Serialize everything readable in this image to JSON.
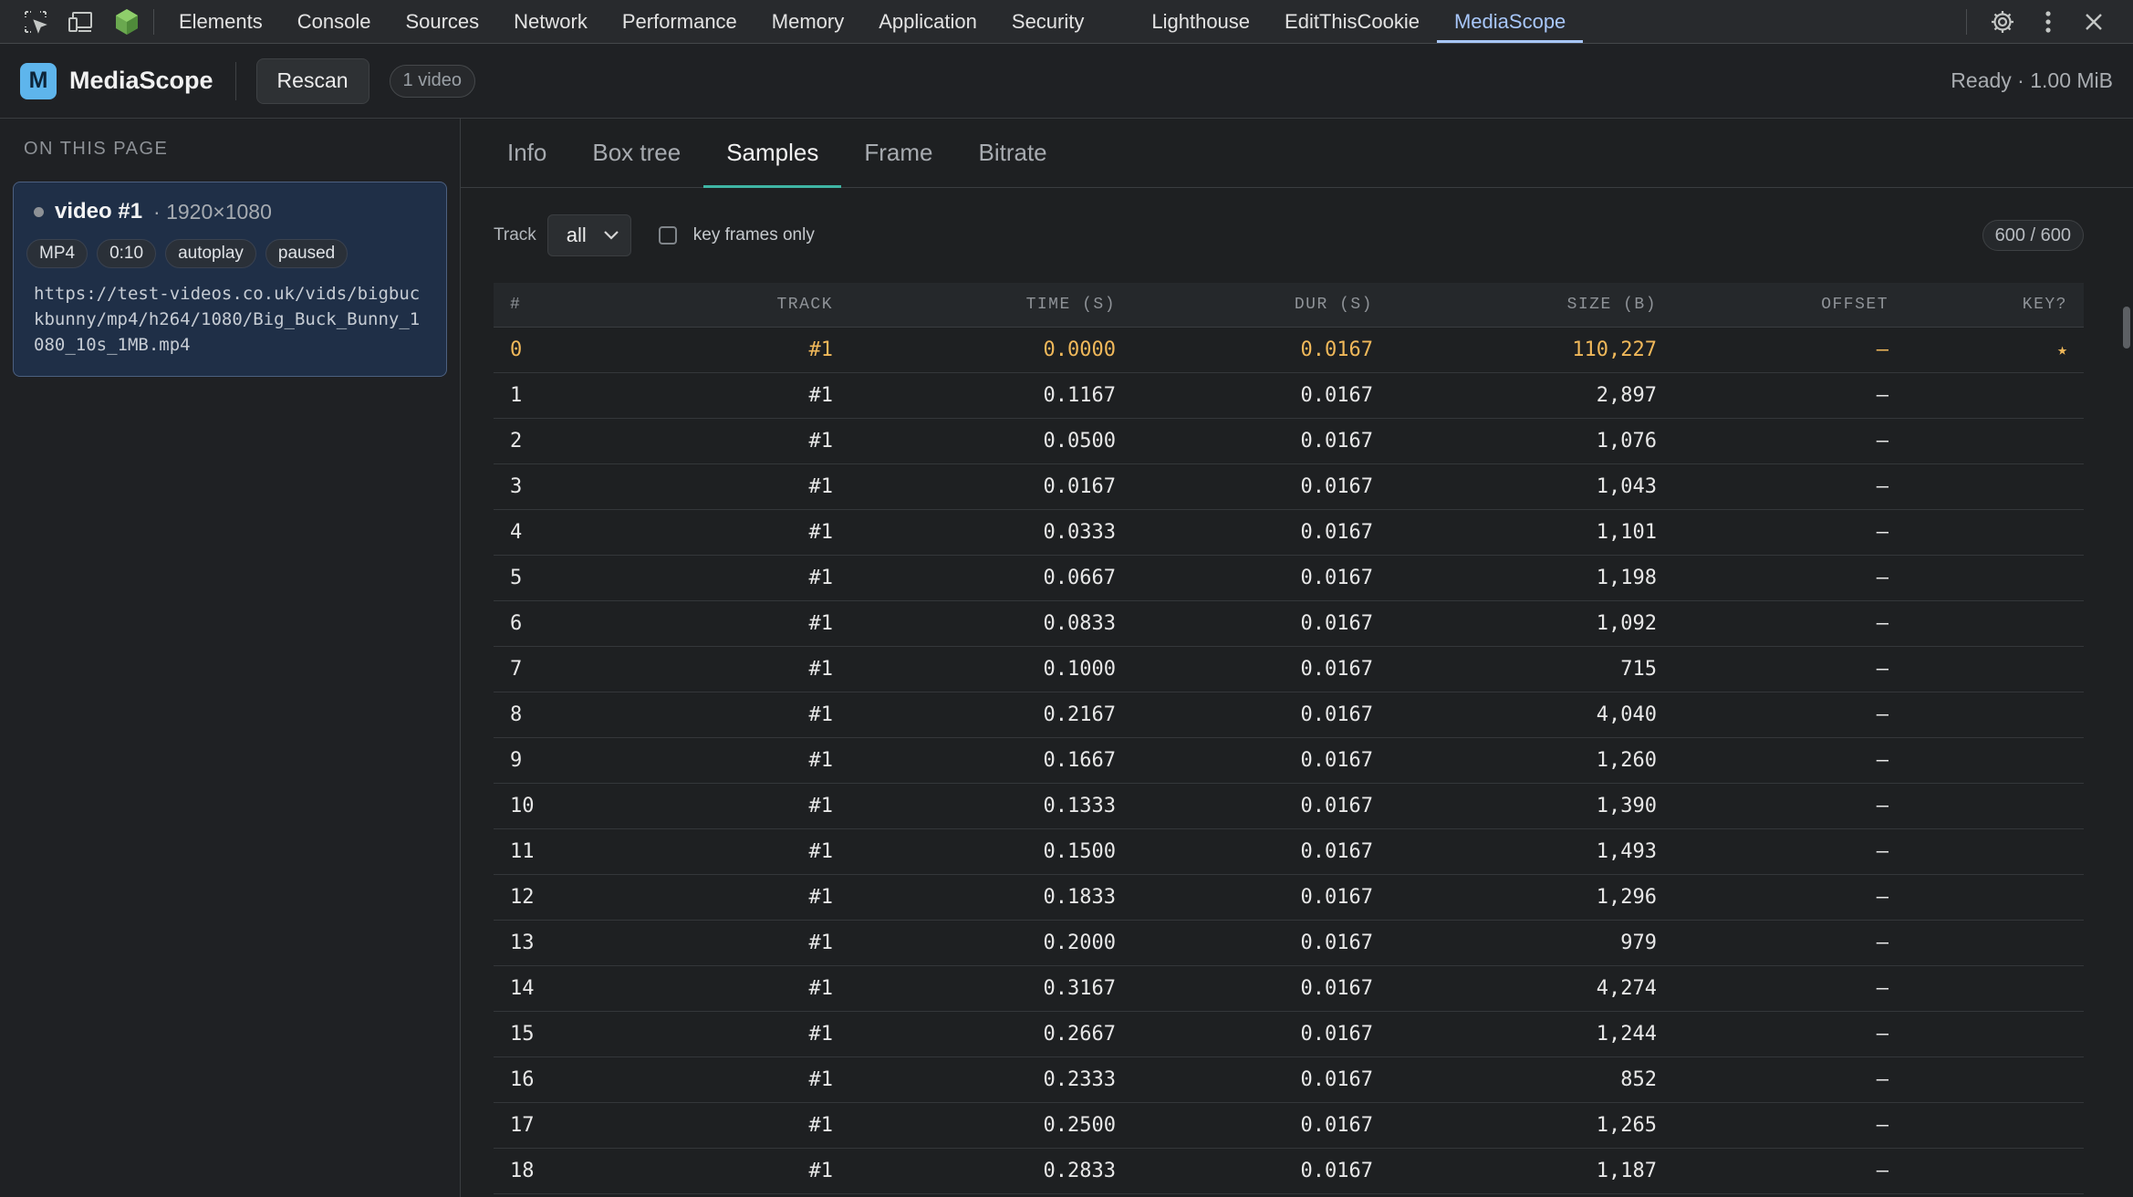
{
  "devtools": {
    "tabs": [
      "Elements",
      "Console",
      "Sources",
      "Network",
      "Performance",
      "Memory",
      "Application",
      "Security",
      "Lighthouse",
      "EditThisCookie",
      "MediaScope"
    ],
    "active_tab": "MediaScope",
    "left_icons": [
      "inspect-element-icon",
      "device-toolbar-icon",
      "extension-cube-icon"
    ],
    "right_icons": [
      "settings-gear-icon",
      "more-options-icon",
      "close-icon"
    ]
  },
  "header": {
    "logo_letter": "M",
    "app_name": "MediaScope",
    "rescan_label": "Rescan",
    "video_count": "1 video",
    "status": "Ready · 1.00 MiB"
  },
  "sidebar": {
    "heading": "ON THIS PAGE",
    "video": {
      "name": "video #1",
      "resolution": "· 1920×1080",
      "chips": [
        "MP4",
        "0:10",
        "autoplay",
        "paused"
      ],
      "url": "https://test-videos.co.uk/vids/bigbuckbunny/mp4/h264/1080/Big_Buck_Bunny_1080_10s_1MB.mp4"
    }
  },
  "subtabs": {
    "items": [
      "Info",
      "Box tree",
      "Samples",
      "Frame",
      "Bitrate"
    ],
    "active": "Samples"
  },
  "filters": {
    "track_label": "Track",
    "track_value": "all",
    "keyframes_label": "key frames only",
    "keyframes_checked": false,
    "total": "600 / 600"
  },
  "table": {
    "columns": [
      "#",
      "TRACK",
      "TIME (S)",
      "DUR (S)",
      "SIZE (B)",
      "OFFSET",
      "KEY?"
    ],
    "rows": [
      [
        "0",
        "#1",
        "0.0000",
        "0.0167",
        "110,227",
        "—",
        "★"
      ],
      [
        "1",
        "#1",
        "0.1167",
        "0.0167",
        "2,897",
        "—",
        ""
      ],
      [
        "2",
        "#1",
        "0.0500",
        "0.0167",
        "1,076",
        "—",
        ""
      ],
      [
        "3",
        "#1",
        "0.0167",
        "0.0167",
        "1,043",
        "—",
        ""
      ],
      [
        "4",
        "#1",
        "0.0333",
        "0.0167",
        "1,101",
        "—",
        ""
      ],
      [
        "5",
        "#1",
        "0.0667",
        "0.0167",
        "1,198",
        "—",
        ""
      ],
      [
        "6",
        "#1",
        "0.0833",
        "0.0167",
        "1,092",
        "—",
        ""
      ],
      [
        "7",
        "#1",
        "0.1000",
        "0.0167",
        "715",
        "—",
        ""
      ],
      [
        "8",
        "#1",
        "0.2167",
        "0.0167",
        "4,040",
        "—",
        ""
      ],
      [
        "9",
        "#1",
        "0.1667",
        "0.0167",
        "1,260",
        "—",
        ""
      ],
      [
        "10",
        "#1",
        "0.1333",
        "0.0167",
        "1,390",
        "—",
        ""
      ],
      [
        "11",
        "#1",
        "0.1500",
        "0.0167",
        "1,493",
        "—",
        ""
      ],
      [
        "12",
        "#1",
        "0.1833",
        "0.0167",
        "1,296",
        "—",
        ""
      ],
      [
        "13",
        "#1",
        "0.2000",
        "0.0167",
        "979",
        "—",
        ""
      ],
      [
        "14",
        "#1",
        "0.3167",
        "0.0167",
        "4,274",
        "—",
        ""
      ],
      [
        "15",
        "#1",
        "0.2667",
        "0.0167",
        "1,244",
        "—",
        ""
      ],
      [
        "16",
        "#1",
        "0.2333",
        "0.0167",
        "852",
        "—",
        ""
      ],
      [
        "17",
        "#1",
        "0.2500",
        "0.0167",
        "1,265",
        "—",
        ""
      ],
      [
        "18",
        "#1",
        "0.2833",
        "0.0167",
        "1,187",
        "—",
        ""
      ]
    ],
    "key_row_index": 0
  },
  "colors": {
    "accent_tab": "#a8c7fa",
    "subtab_underline": "#3fb5a4",
    "keyframe_highlight": "#f0b85a",
    "logo": "#5eb5ec"
  }
}
